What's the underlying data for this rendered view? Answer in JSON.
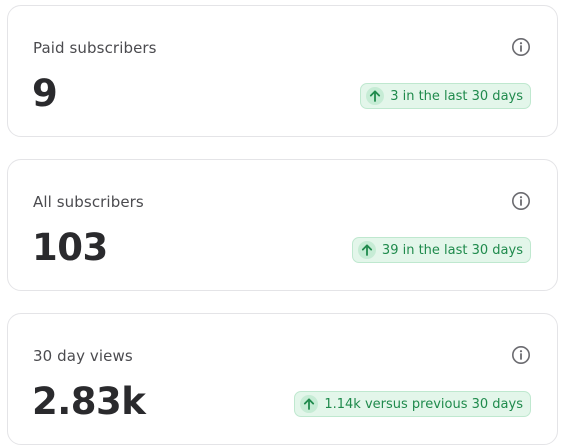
{
  "theme": {
    "badge_bg": "#e3f6ea",
    "badge_text": "#1f8a4c",
    "label_text": "#4b4b4f",
    "value_text": "#2a2a2d",
    "card_border": "#e4e4e7"
  },
  "cards": [
    {
      "label": "Paid subscribers",
      "value": "9",
      "trend": "3 in the last 30 days",
      "trend_icon": "arrow-up-icon",
      "info_icon": "info-icon"
    },
    {
      "label": "All subscribers",
      "value": "103",
      "trend": "39 in the last 30 days",
      "trend_icon": "arrow-up-icon",
      "info_icon": "info-icon"
    },
    {
      "label": "30 day views",
      "value": "2.83k",
      "trend": "1.14k versus previous 30 days",
      "trend_icon": "arrow-up-icon",
      "info_icon": "info-icon"
    }
  ]
}
